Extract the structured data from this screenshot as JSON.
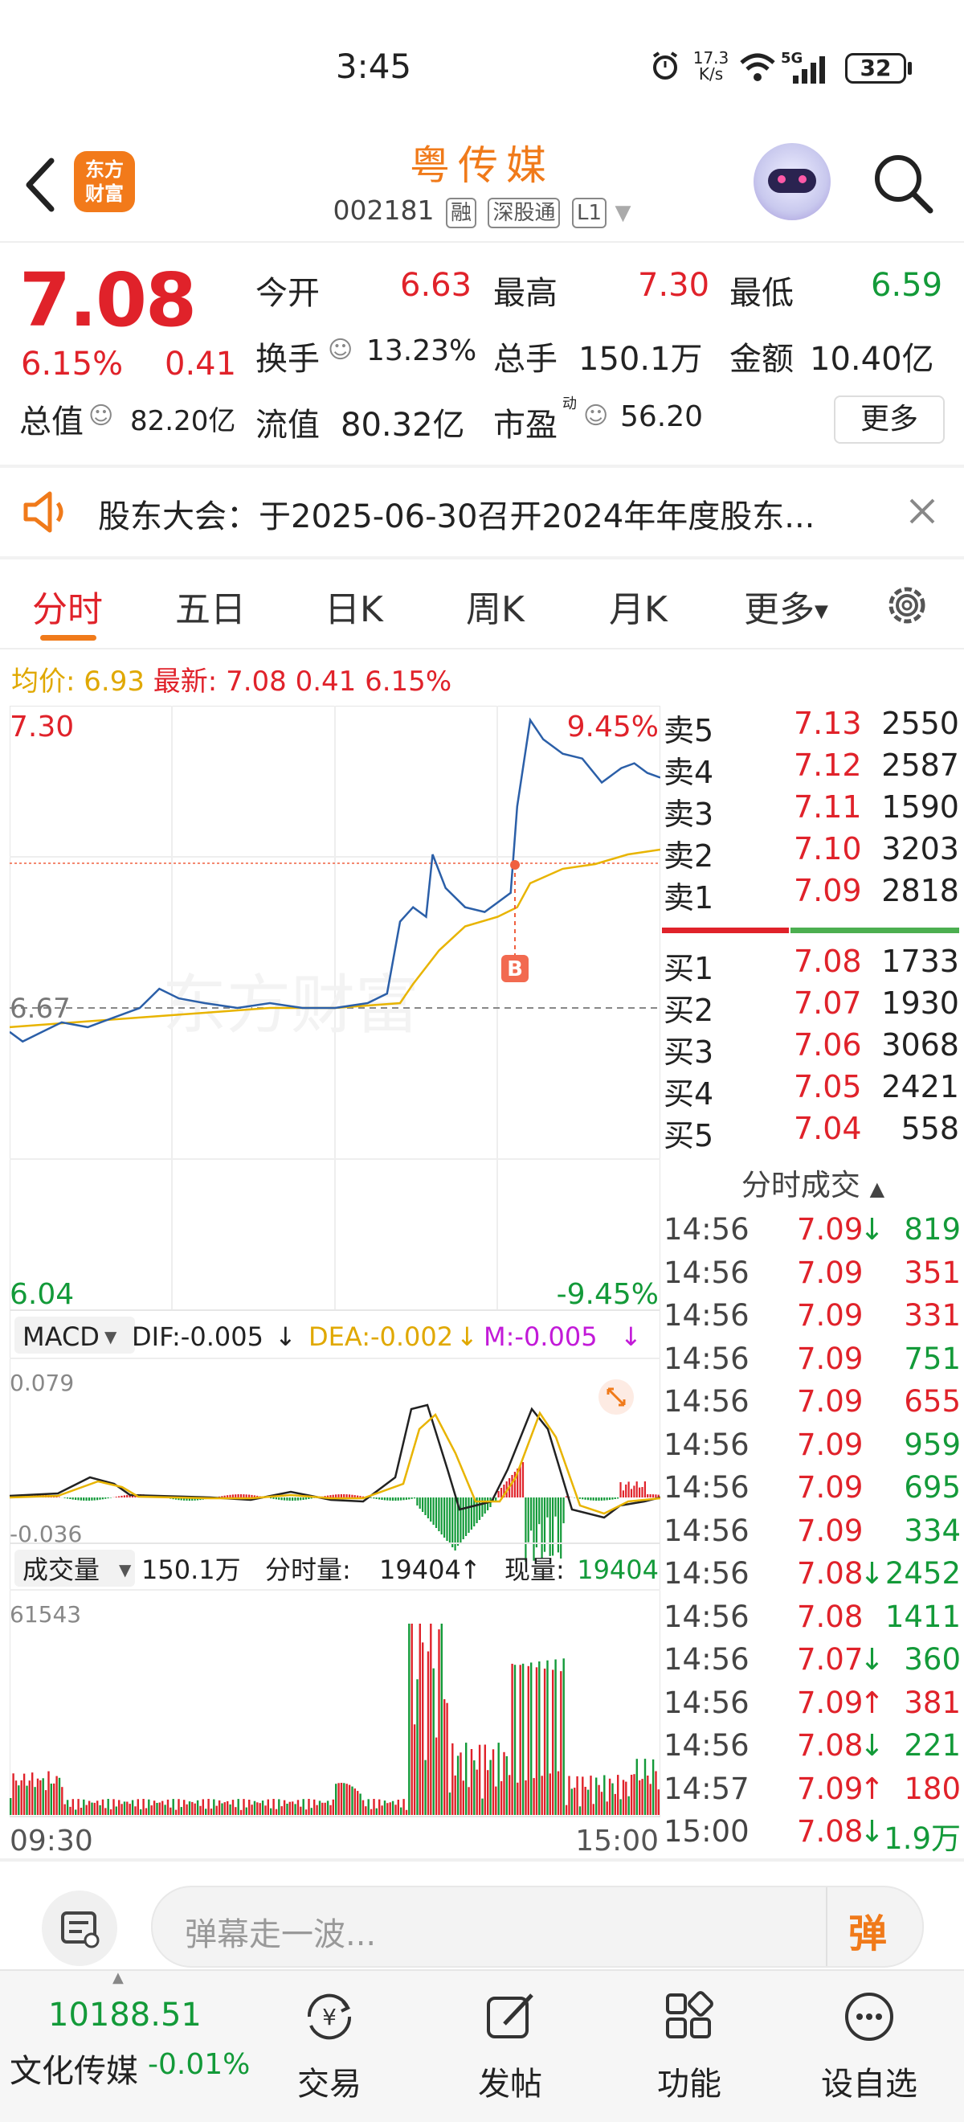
{
  "status_bar": {
    "time": "3:45",
    "speed": "17.3",
    "speed_unit": "K/s",
    "network": "5G",
    "battery": "32"
  },
  "header": {
    "logo_line1": "东方",
    "logo_line2": "财富",
    "stock_name": "粤传媒",
    "stock_code": "002181",
    "tag1": "融",
    "tag2": "深股通",
    "tag3": "L1"
  },
  "quote": {
    "price": "7.08",
    "change_pct": "6.15%",
    "change": "0.41",
    "open_label": "今开",
    "open": "6.63",
    "high_label": "最高",
    "high": "7.30",
    "low_label": "最低",
    "low": "6.59",
    "turnover_label": "换手",
    "turnover": "13.23%",
    "volume_label": "总手",
    "volume": "150.1万",
    "amount_label": "金额",
    "amount": "10.40亿",
    "mktcap_label": "总值",
    "mktcap": "82.20亿",
    "float_label": "流值",
    "float": "80.32亿",
    "pe_label": "市盈",
    "pe_sup": "动",
    "pe": "56.20",
    "more_label": "更多"
  },
  "notice": {
    "text": "股东大会：于2025-06-30召开2024年年度股东..."
  },
  "tabs": [
    "分时",
    "五日",
    "日K",
    "周K",
    "月K",
    "更多"
  ],
  "avg_line": {
    "avg_label": "均价:",
    "avg": "6.93",
    "latest_label": "最新:",
    "latest": "7.08",
    "chg": "0.41",
    "pct": "6.15%"
  },
  "chart_labels": {
    "top_price": "7.30",
    "top_pct": "9.45%",
    "ref_price": "6.67",
    "bottom_price": "6.04",
    "bottom_pct": "-9.45%",
    "macd_label": "MACD",
    "dif": "DIF:-0.005",
    "dea": "DEA:-0.002",
    "m": "M:-0.005",
    "macd_max": "0.079",
    "macd_min": "-0.036",
    "vol_label": "成交量",
    "vol_total": "150.1万",
    "vol_fs_label": "分时量:",
    "vol_fs": "19404",
    "vol_now_label": "现量:",
    "vol_now": "19404",
    "vol_max": "61543",
    "time_start": "09:30",
    "time_end": "15:00",
    "trade_marker": "B",
    "watermark": "东方财富"
  },
  "chart_data": {
    "type": "line",
    "title": "",
    "x_range": [
      "09:30",
      "15:00"
    ],
    "ylim": [
      6.04,
      7.3
    ],
    "reference_price": 6.67,
    "series": [
      {
        "name": "",
        "points": [
          [
            0,
            6.62
          ],
          [
            0.02,
            6.6
          ],
          [
            0.05,
            6.62
          ],
          [
            0.08,
            6.64
          ],
          [
            0.12,
            6.63
          ],
          [
            0.16,
            6.65
          ],
          [
            0.2,
            6.67
          ],
          [
            0.23,
            6.71
          ],
          [
            0.26,
            6.69
          ],
          [
            0.3,
            6.68
          ],
          [
            0.35,
            6.67
          ],
          [
            0.4,
            6.68
          ],
          [
            0.45,
            6.67
          ],
          [
            0.5,
            6.67
          ],
          [
            0.55,
            6.68
          ],
          [
            0.58,
            6.7
          ],
          [
            0.6,
            6.85
          ],
          [
            0.62,
            6.88
          ],
          [
            0.64,
            6.86
          ],
          [
            0.65,
            6.99
          ],
          [
            0.67,
            6.92
          ],
          [
            0.7,
            6.88
          ],
          [
            0.73,
            6.87
          ],
          [
            0.75,
            6.89
          ],
          [
            0.77,
            6.91
          ],
          [
            0.78,
            7.09
          ],
          [
            0.8,
            7.27
          ],
          [
            0.82,
            7.23
          ],
          [
            0.85,
            7.2
          ],
          [
            0.88,
            7.19
          ],
          [
            0.91,
            7.14
          ],
          [
            0.94,
            7.17
          ],
          [
            0.96,
            7.18
          ],
          [
            0.98,
            7.16
          ],
          [
            1.0,
            7.15
          ]
        ]
      },
      {
        "name": "均价",
        "points": [
          [
            0,
            6.63
          ],
          [
            0.1,
            6.64
          ],
          [
            0.2,
            6.65
          ],
          [
            0.3,
            6.66
          ],
          [
            0.4,
            6.67
          ],
          [
            0.5,
            6.67
          ],
          [
            0.6,
            6.68
          ],
          [
            0.62,
            6.72
          ],
          [
            0.66,
            6.79
          ],
          [
            0.7,
            6.84
          ],
          [
            0.75,
            6.86
          ],
          [
            0.78,
            6.88
          ],
          [
            0.8,
            6.93
          ],
          [
            0.85,
            6.96
          ],
          [
            0.9,
            6.97
          ],
          [
            0.95,
            6.99
          ],
          [
            1.0,
            7.0
          ]
        ]
      }
    ],
    "volume_ylim": [
      0,
      61543
    ]
  },
  "order_book": {
    "asks": [
      {
        "label": "卖5",
        "price": "7.13",
        "qty": "2550"
      },
      {
        "label": "卖4",
        "price": "7.12",
        "qty": "2587"
      },
      {
        "label": "卖3",
        "price": "7.11",
        "qty": "1590"
      },
      {
        "label": "卖2",
        "price": "7.10",
        "qty": "3203"
      },
      {
        "label": "卖1",
        "price": "7.09",
        "qty": "2818"
      }
    ],
    "bids": [
      {
        "label": "买1",
        "price": "7.08",
        "qty": "1733"
      },
      {
        "label": "买2",
        "price": "7.07",
        "qty": "1930"
      },
      {
        "label": "买3",
        "price": "7.06",
        "qty": "3068"
      },
      {
        "label": "买4",
        "price": "7.05",
        "qty": "2421"
      },
      {
        "label": "买5",
        "price": "7.04",
        "qty": "558"
      }
    ],
    "ticks_title": "分时成交",
    "ticks": [
      {
        "time": "14:56",
        "price": "7.09",
        "arrow": "↓",
        "qty": "819",
        "color": "green"
      },
      {
        "time": "14:56",
        "price": "7.09",
        "arrow": "",
        "qty": "351",
        "color": "red"
      },
      {
        "time": "14:56",
        "price": "7.09",
        "arrow": "",
        "qty": "331",
        "color": "red"
      },
      {
        "time": "14:56",
        "price": "7.09",
        "arrow": "",
        "qty": "751",
        "color": "green"
      },
      {
        "time": "14:56",
        "price": "7.09",
        "arrow": "",
        "qty": "655",
        "color": "red"
      },
      {
        "time": "14:56",
        "price": "7.09",
        "arrow": "",
        "qty": "959",
        "color": "green"
      },
      {
        "time": "14:56",
        "price": "7.09",
        "arrow": "",
        "qty": "695",
        "color": "green"
      },
      {
        "time": "14:56",
        "price": "7.09",
        "arrow": "",
        "qty": "334",
        "color": "green"
      },
      {
        "time": "14:56",
        "price": "7.08",
        "arrow": "↓",
        "qty": "2452",
        "color": "green"
      },
      {
        "time": "14:56",
        "price": "7.08",
        "arrow": "",
        "qty": "1411",
        "color": "green"
      },
      {
        "time": "14:56",
        "price": "7.07",
        "arrow": "↓",
        "qty": "360",
        "color": "green"
      },
      {
        "time": "14:56",
        "price": "7.09",
        "arrow": "↑",
        "qty": "381",
        "color": "red"
      },
      {
        "time": "14:56",
        "price": "7.08",
        "arrow": "↓",
        "qty": "221",
        "color": "green"
      },
      {
        "time": "14:57",
        "price": "7.09",
        "arrow": "↑",
        "qty": "180",
        "color": "red"
      },
      {
        "time": "15:00",
        "price": "7.08",
        "arrow": "↓",
        "qty": "1.9万",
        "color": "green"
      }
    ]
  },
  "danmu": {
    "placeholder": "弹幕走一波...",
    "button": "弹"
  },
  "bottom_nav": {
    "index_value": "10188.51",
    "index_name": "文化传媒",
    "index_change": "-0.01%",
    "items": [
      "交易",
      "发帖",
      "功能",
      "设自选"
    ]
  },
  "colors": {
    "red": "#e0222a",
    "green": "#139a39",
    "orange": "#f07a1a",
    "gold": "#e0a800",
    "blue": "#2b5fa8"
  }
}
